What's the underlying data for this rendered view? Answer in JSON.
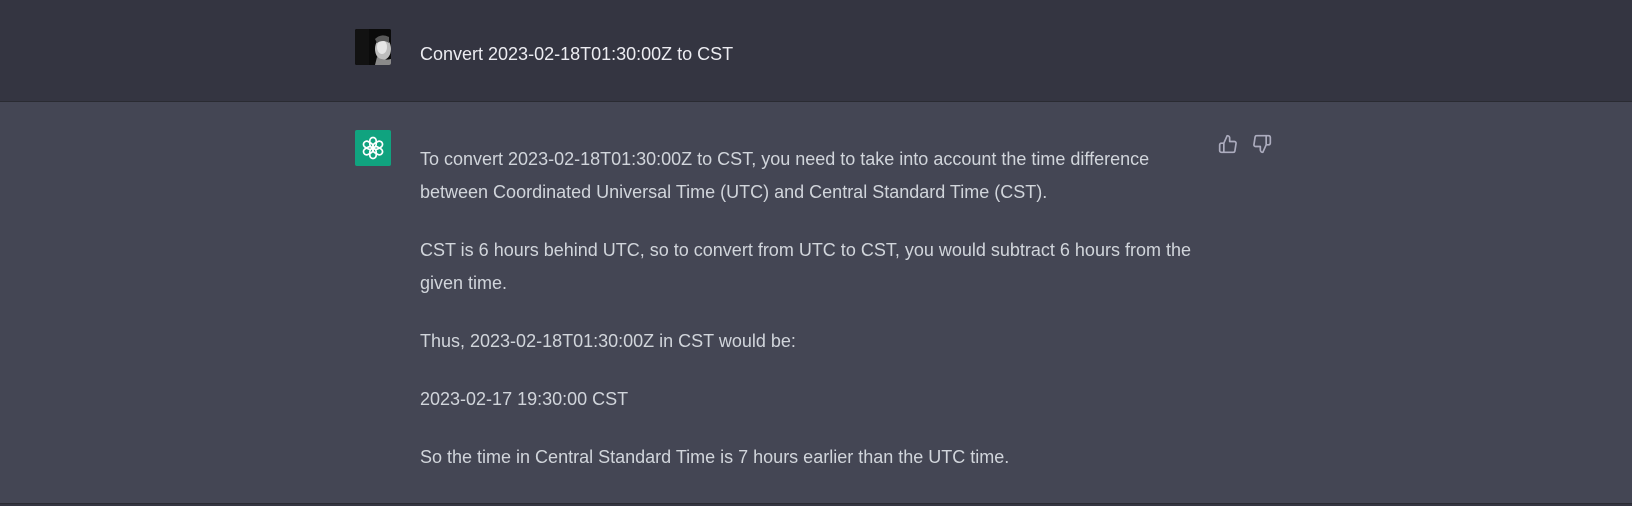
{
  "user_message": {
    "text": "Convert 2023-02-18T01:30:00Z to CST"
  },
  "assistant_message": {
    "paragraphs": [
      "To convert 2023-02-18T01:30:00Z to CST, you need to take into account the time difference between Coordinated Universal Time (UTC) and Central Standard Time (CST).",
      "CST is 6 hours behind UTC, so to convert from UTC to CST, you would subtract 6 hours from the given time.",
      "Thus, 2023-02-18T01:30:00Z in CST would be:",
      "2023-02-17 19:30:00 CST",
      "So the time in Central Standard Time is 7 hours earlier than the UTC time."
    ]
  },
  "icons": {
    "user_avatar": "user-avatar-photo",
    "bot_avatar": "openai-logo-icon",
    "thumbs_up": "thumbs-up-icon",
    "thumbs_down": "thumbs-down-icon"
  },
  "colors": {
    "background": "#343541",
    "assistant_background": "#444654",
    "bot_avatar": "#10a37f",
    "user_text": "#ececf1",
    "assistant_text": "#d1d5db",
    "icon": "#acacbe"
  }
}
